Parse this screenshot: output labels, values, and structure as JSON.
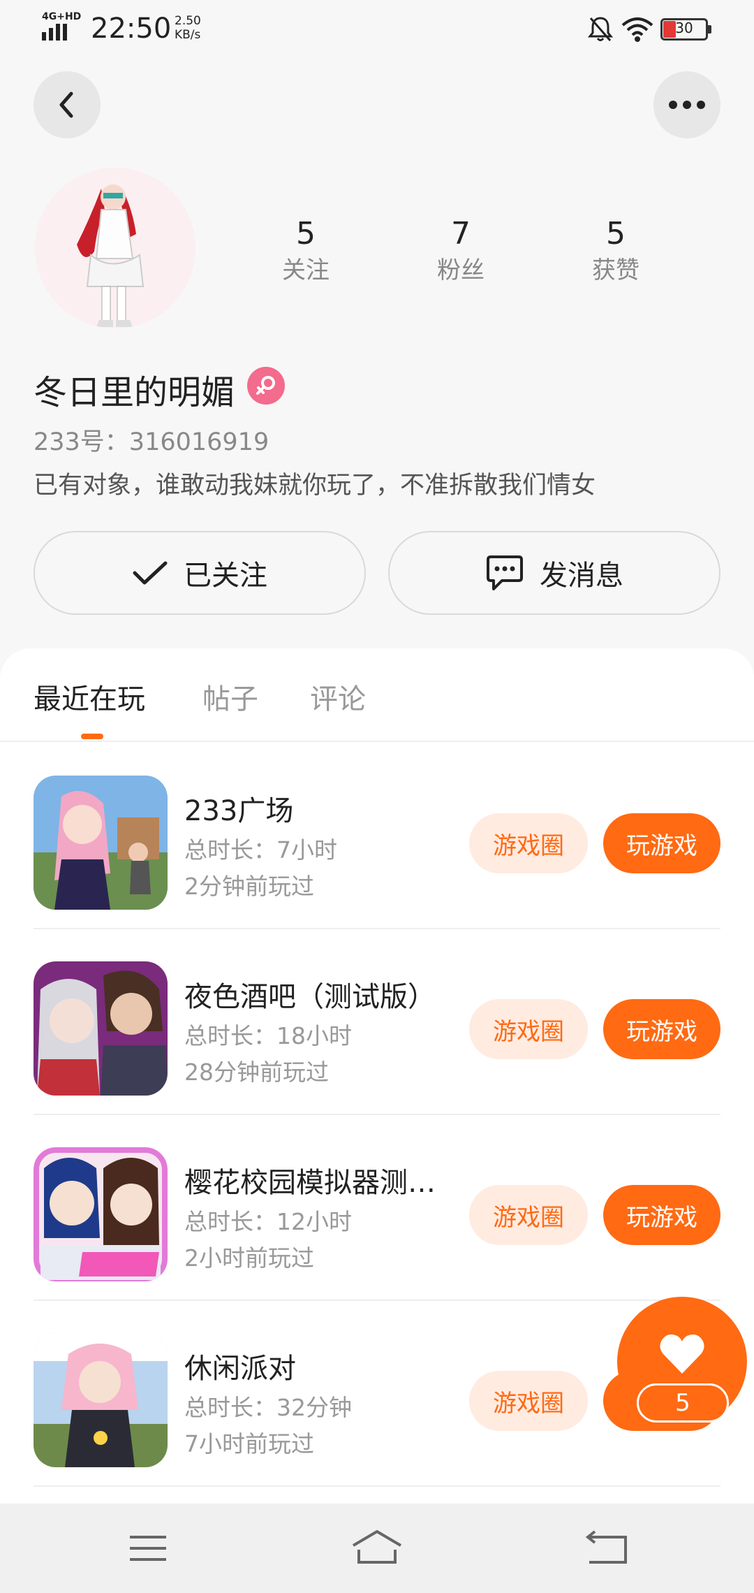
{
  "status_bar": {
    "network": "4G+HD",
    "time": "22:50",
    "speed_value": "2.50",
    "speed_unit": "KB/s",
    "battery": "30",
    "icons": [
      "signal-icon",
      "bell-muted-icon",
      "wifi-icon",
      "battery-icon"
    ]
  },
  "header": {
    "back_icon": "chevron-left-icon",
    "more_icon": "more-dots-icon"
  },
  "profile": {
    "stats": [
      {
        "value": "5",
        "label": "关注"
      },
      {
        "value": "7",
        "label": "粉丝"
      },
      {
        "value": "5",
        "label": "获赞"
      }
    ],
    "username": "冬日里的明媚",
    "gender_icon": "female-icon",
    "uid": "233号：316016919",
    "bio": "已有对象，谁敢动我妹就你玩了，不准拆散我们情女",
    "follow_label": "已关注",
    "message_label": "发消息"
  },
  "tabs": [
    {
      "label": "最近在玩",
      "active": true
    },
    {
      "label": "帖子",
      "active": false
    },
    {
      "label": "评论",
      "active": false
    }
  ],
  "games": [
    {
      "title": "233广场",
      "duration": "总时长：7小时",
      "last_played": "2分钟前玩过",
      "circle_label": "游戏圈",
      "play_label": "玩游戏"
    },
    {
      "title": "夜色酒吧（测试版）",
      "duration": "总时长：18小时",
      "last_played": "28分钟前玩过",
      "circle_label": "游戏圈",
      "play_label": "玩游戏"
    },
    {
      "title": "樱花校园模拟器测…",
      "duration": "总时长：12小时",
      "last_played": "2小时前玩过",
      "circle_label": "游戏圈",
      "play_label": "玩游戏"
    },
    {
      "title": "休闲派对",
      "duration": "总时长：32分钟",
      "last_played": "7小时前玩过",
      "circle_label": "游戏圈",
      "play_label": "玩"
    }
  ],
  "like_fab": {
    "count": "5",
    "icon": "heart-icon"
  },
  "colors": {
    "accent": "#ff6a13",
    "accent_light": "#ffebe0",
    "gender": "#f36b8d"
  }
}
